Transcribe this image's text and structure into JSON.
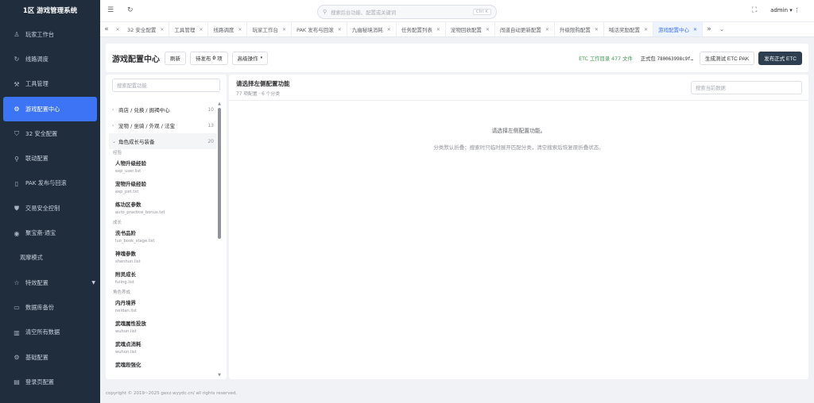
{
  "app": {
    "title": "1区 游戏管理系统"
  },
  "sidebar": {
    "items": [
      {
        "label": "玩家工作台",
        "icon": "user-icon",
        "glyph": "♙"
      },
      {
        "label": "线路调度",
        "icon": "refresh-icon",
        "glyph": "↻"
      },
      {
        "label": "工具管理",
        "icon": "tools-icon",
        "glyph": "⚒"
      },
      {
        "label": "游戏配置中心",
        "icon": "settings-icon",
        "glyph": "⚙",
        "active": true
      },
      {
        "label": "32 安全配置",
        "icon": "shield-icon",
        "glyph": "⛉"
      },
      {
        "label": "联动配置",
        "icon": "link-icon",
        "glyph": "⚲"
      },
      {
        "label": "PAK 发布与回滚",
        "icon": "document-icon",
        "glyph": "▯"
      },
      {
        "label": "交易安全控制",
        "icon": "check-shield-icon",
        "glyph": "⛊"
      },
      {
        "label": "聚宝斋·通宝",
        "icon": "gem-icon",
        "glyph": "◉"
      },
      {
        "label": "观摩模式",
        "icon": "",
        "glyph": ""
      },
      {
        "label": "特效配置",
        "icon": "star-icon",
        "glyph": "☆"
      },
      {
        "label": "数据库备份",
        "icon": "database-icon",
        "glyph": "▭"
      },
      {
        "label": "清空所有数据",
        "icon": "trash-icon",
        "glyph": "▥"
      },
      {
        "label": "基础配置",
        "icon": "gear-icon",
        "glyph": "⚙"
      },
      {
        "label": "登录页配置",
        "icon": "login-icon",
        "glyph": "▤"
      }
    ]
  },
  "header": {
    "search_placeholder": "搜索后台功能、配置或关键词",
    "search_kbd": "Ctrl K",
    "user": "admin"
  },
  "tabs": [
    "32 安全配置",
    "工具管理",
    "线路调度",
    "玩家工作台",
    "PAK 发布与回滚",
    "九幽秘境消耗",
    "任务配置列表",
    "宠物回收配置",
    "闯道自动更新配置",
    "升级限购配置",
    "喊话奖励配置",
    "游戏配置中心"
  ],
  "toolbar": {
    "title": "游戏配置中心",
    "refresh": "刷新",
    "pending_label": "待发布",
    "pending_count": "0",
    "pending_unit": "项",
    "advanced": "高级操作",
    "etc_status": "ETC 工作目录 477 文件",
    "pkg_label": "正式包",
    "pkg_hash": "780063998c9f…",
    "gen_test": "生成测试 ETC PAK",
    "publish": "发布正式 ETC"
  },
  "left_panel": {
    "search_placeholder": "搜索配置功能",
    "groups": [
      {
        "label": "商店 / 兑换 / 掘褐中心",
        "count": "10"
      },
      {
        "label": "宠物 / 坐骑 / 外观 / 法宝",
        "count": "13"
      },
      {
        "label": "角色成长与装备",
        "count": "20"
      }
    ],
    "subcats": [
      "经验",
      "成长",
      "角色养成"
    ],
    "items": [
      {
        "name": "人物升级经验",
        "file": "exp_user.list"
      },
      {
        "name": "宠物升级经验",
        "file": "exp_pet.txt"
      },
      {
        "name": "练功区参数",
        "file": "auto_practice_bonus.txt"
      },
      {
        "name": "洗书品阶",
        "file": "luo_book_stage.list"
      },
      {
        "name": "神魂参数",
        "file": "shenhun.list"
      },
      {
        "name": "附灵成长",
        "file": "fuling.list"
      },
      {
        "name": "内丹境界",
        "file": "neidan.list"
      },
      {
        "name": "武魂属性投放",
        "file": "wuhun.list"
      },
      {
        "name": "武魂点消耗",
        "file": "wuhun.list"
      },
      {
        "name": "武魂段强化",
        "file": ""
      }
    ]
  },
  "right_panel": {
    "title": "请选择左侧配置功能",
    "subtitle": "77 项配置 · 6 个分类",
    "search_placeholder": "搜索当前数据",
    "empty_main": "请选择左侧配置功能。",
    "empty_hint": "分类默认折叠；搜索时只临时展开匹配分类，清空搜索后恢复原折叠状态。"
  },
  "footer": {
    "copyright": "copyright © 2019~2025 gexz.wyydc.cn/ all rights reserved."
  }
}
